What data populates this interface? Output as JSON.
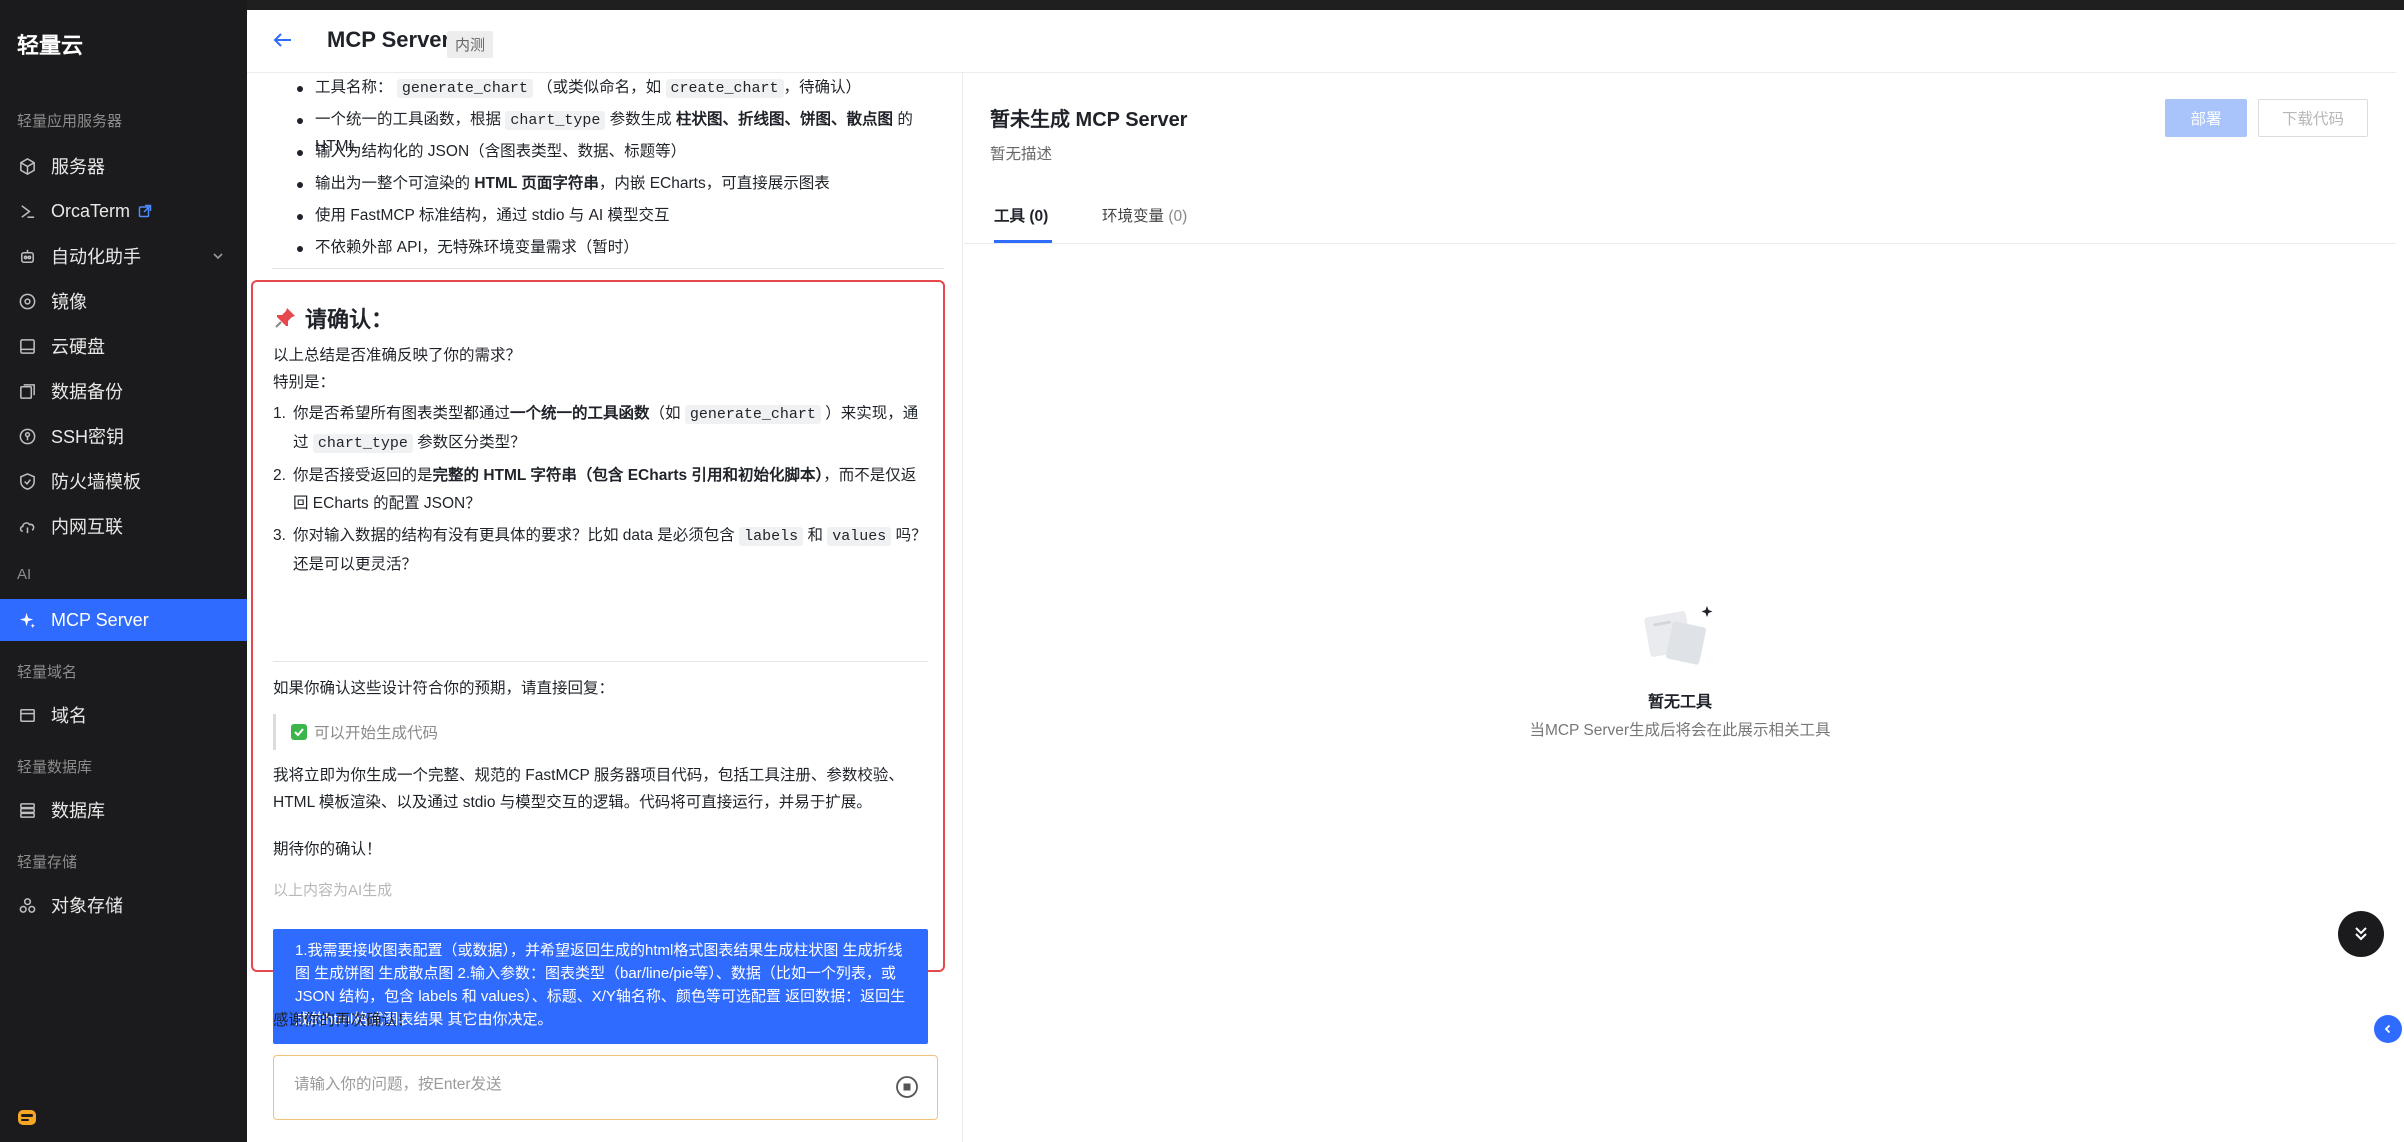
{
  "sidebar": {
    "brand": "轻量云",
    "sections": {
      "light_server": "轻量应用服务器",
      "ai": "AI",
      "light_domain": "轻量域名",
      "light_db": "轻量数据库",
      "light_storage": "轻量存储"
    },
    "items": {
      "server": "服务器",
      "orcaterm": "OrcaTerm",
      "automation": "自动化助手",
      "image": "镜像",
      "cloud_disk": "云硬盘",
      "backup": "数据备份",
      "ssh": "SSH密钥",
      "firewall": "防火墙模板",
      "intranet": "内网互联",
      "mcp": "MCP Server",
      "domain": "域名",
      "database": "数据库",
      "object_storage": "对象存储"
    }
  },
  "header": {
    "title": "MCP Server",
    "badge": "内测"
  },
  "chat": {
    "bullets": {
      "b1_pre": "工具名称：",
      "b1_code1": "generate_chart",
      "b1_mid": "（或类似命名，如",
      "b1_code2": "create_chart",
      "b1_post": "，待确认）",
      "b2_pre": "一个统一的工具函数，根据",
      "b2_code": "chart_type",
      "b2_mid": "参数生成",
      "b2_bold": "柱状图、折线图、饼图、散点图",
      "b2_post": "的 HTML",
      "b3": "输入为结构化的 JSON（含图表类型、数据、标题等）",
      "b4_pre": "输出为一整个可渲染的",
      "b4_bold": "HTML 页面字符串",
      "b4_post": "，内嵌 ECharts，可直接展示图表",
      "b5": "使用 FastMCP 标准结构，通过 stdio 与 AI 模型交互",
      "b6": "不依赖外部 API，无特殊环境变量需求（暂时）"
    },
    "confirm": {
      "title": "请确认：",
      "q_intro": "以上总结是否准确反映了你的需求？",
      "q_special": "特别是：",
      "items": {
        "i1_num": "1.",
        "i1_pre": "你是否希望所有图表类型都通过",
        "i1_bold": "一个统一的工具函数",
        "i1_mid": "（如",
        "i1_code1": "generate_chart",
        "i1_mid2": "）来实现，通过",
        "i1_code2": "chart_type",
        "i1_post": "参数区分类型？",
        "i2_num": "2.",
        "i2_pre": "你是否接受返回的是",
        "i2_bold": "完整的 HTML 字符串（包含 ECharts 引用和初始化脚本）",
        "i2_post": "，而不是仅返回 ECharts 的配置 JSON？",
        "i3_num": "3.",
        "i3_pre": "你对输入数据的结构有没有更具体的要求？比如 data 是必须包含",
        "i3_code1": "labels",
        "i3_mid": "和",
        "i3_code2": "values",
        "i3_post": "吗？还是可以更灵活？"
      },
      "reply_prompt": "如果你确认这些设计符合你的预期，请直接回复：",
      "quote": "可以开始生成代码",
      "plan": "我将立即为你生成一个完整、规范的 FastMCP 服务器项目代码，包括工具注册、参数校验、HTML 模板渲染、以及通过 stdio 与模型交互的逻辑。代码将可直接运行，并易于扩展。",
      "expect": "期待你的确认！",
      "ai_note": "以上内容为AI生成"
    },
    "user_message": "1.我需要接收图表配置（或数据），并希望返回生成的html格式图表结果生成柱状图 生成折线图 生成饼图 生成散点图 2.输入参数：图表类型（bar/line/pie等）、数据（比如一个列表，或 JSON 结构，包含 labels 和 values）、标题、X/Y轴名称、颜色等可选配置 返回数据：返回生成的html格式图表结果 其它由你决定。",
    "thanks": "感谢你的再次确认！",
    "input_placeholder": "请输入你的问题，按Enter发送"
  },
  "right": {
    "title": "暂未生成 MCP Server",
    "desc": "暂无描述",
    "deploy_label": "部署",
    "download_label": "下载代码",
    "tabs": {
      "tools_label": "工具",
      "tools_count": "(0)",
      "env_label": "环境变量",
      "env_count": "(0)"
    },
    "empty_title": "暂无工具",
    "empty_sub": "当MCP Server生成后将会在此展示相关工具"
  },
  "colors": {
    "accent": "#2f6bff",
    "sidebar_bg": "#1b1b1d",
    "highlight_border": "#e5484d"
  }
}
